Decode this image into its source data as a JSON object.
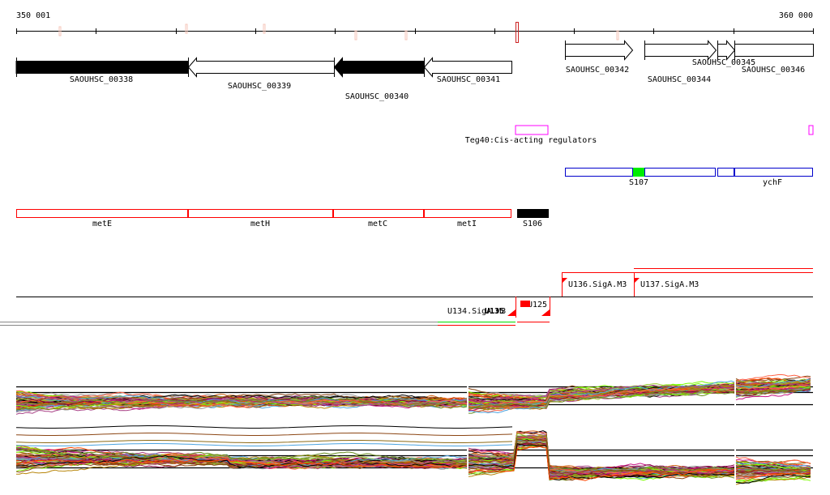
{
  "ruler": {
    "start_label": "350 001",
    "end_label": "360 000"
  },
  "genes": [
    {
      "name": "SAOUHSC_00338",
      "strand": "-",
      "filled": true
    },
    {
      "name": "SAOUHSC_00339",
      "strand": "-",
      "filled": false
    },
    {
      "name": "SAOUHSC_00340",
      "strand": "-",
      "filled": true
    },
    {
      "name": "SAOUHSC_00341",
      "strand": "-",
      "filled": false
    },
    {
      "name": "SAOUHSC_00342",
      "strand": "+",
      "filled": false
    },
    {
      "name": "SAOUHSC_00344",
      "strand": "+",
      "filled": false
    },
    {
      "name": "SAOUHSC_00345",
      "strand": "+",
      "filled": false
    },
    {
      "name": "SAOUHSC_00346",
      "strand": "+",
      "filled": false
    }
  ],
  "regulators": {
    "label": "Teg40:Cis-acting regulators",
    "color": "#ff00ff"
  },
  "operons_blue": {
    "labels": [
      "S107",
      "ychF"
    ],
    "color": "#0000cc",
    "highlight": "#00ee00"
  },
  "operons_red": {
    "labels": [
      "metE",
      "metH",
      "metC",
      "metI",
      "S106"
    ],
    "color": "#ff0000"
  },
  "transcripts": {
    "labels": [
      "U136.SigA.M3",
      "U137.SigA.M3",
      "U134.SigA.M3",
      "U135",
      "U125"
    ],
    "color": "#ff0000"
  },
  "expression": {
    "palette": [
      "#000000",
      "#8b4513",
      "#ff4500",
      "#d2691e",
      "#9acd32",
      "#7cfc00",
      "#b8860b",
      "#c71585",
      "#800040",
      "#4aa3df",
      "#999999",
      "#8b6914",
      "#ff6347",
      "#aa4488",
      "#6b8e23"
    ]
  }
}
